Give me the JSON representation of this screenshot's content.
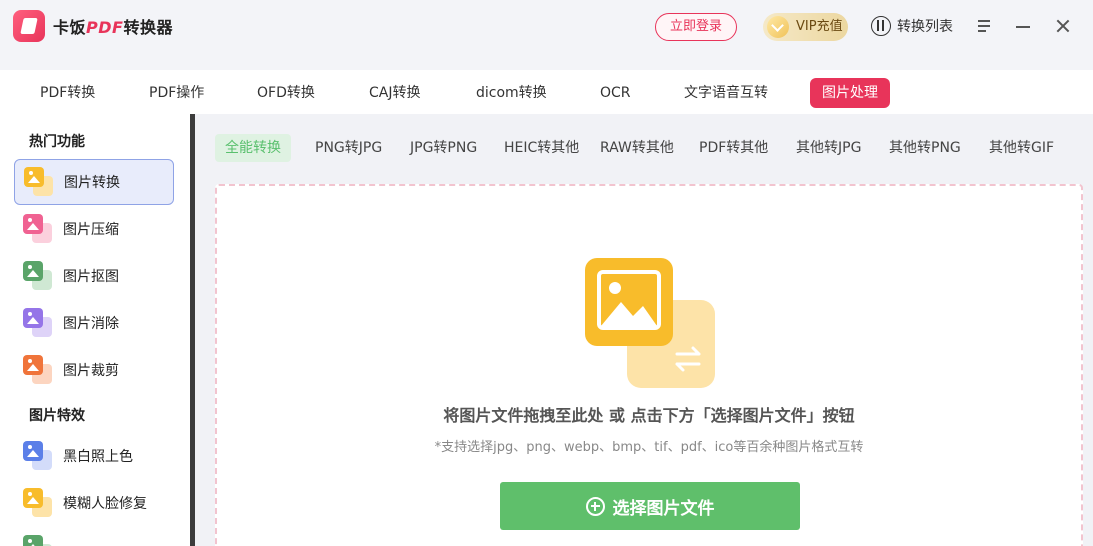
{
  "app": {
    "name_prefix": "卡饭",
    "name_pdf": "PDF",
    "name_suffix": "转换器"
  },
  "header": {
    "login": "立即登录",
    "vip": "VIP充值",
    "convert_list": "转换列表"
  },
  "tabs": [
    {
      "label": "PDF转换"
    },
    {
      "label": "PDF操作"
    },
    {
      "label": "OFD转换"
    },
    {
      "label": "CAJ转换"
    },
    {
      "label": "dicom转换"
    },
    {
      "label": "OCR"
    },
    {
      "label": "文字语音互转"
    },
    {
      "label": "图片处理"
    }
  ],
  "active_tab": "图片处理",
  "sidebar": {
    "group1": "热门功能",
    "items1": [
      {
        "label": "图片转换",
        "icon": "image-convert-icon",
        "color": "#f8bc2b"
      },
      {
        "label": "图片压缩",
        "icon": "image-compress-icon",
        "color": "#f06292"
      },
      {
        "label": "图片抠图",
        "icon": "image-cutout-icon",
        "color": "#5aa469"
      },
      {
        "label": "图片消除",
        "icon": "image-erase-icon",
        "color": "#9575e8"
      },
      {
        "label": "图片裁剪",
        "icon": "image-crop-icon",
        "color": "#f0743a"
      }
    ],
    "group2": "图片特效",
    "items2": [
      {
        "label": "黑白照上色",
        "icon": "colorize-icon",
        "color": "#5b7fe8"
      },
      {
        "label": "模糊人脸修复",
        "icon": "face-restore-icon",
        "color": "#f8bc2b"
      }
    ]
  },
  "subtabs": [
    {
      "label": "全能转换"
    },
    {
      "label": "PNG转JPG"
    },
    {
      "label": "JPG转PNG"
    },
    {
      "label": "HEIC转其他"
    },
    {
      "label": "RAW转其他"
    },
    {
      "label": "PDF转其他"
    },
    {
      "label": "其他转JPG"
    },
    {
      "label": "其他转PNG"
    },
    {
      "label": "其他转GIF"
    }
  ],
  "dropzone": {
    "hint": "将图片文件拖拽至此处 或 点击下方「选择图片文件」按钮",
    "sub": "*支持选择jpg、png、webp、bmp、tif、pdf、ico等百余种图片格式互转",
    "button": "选择图片文件"
  },
  "colors": {
    "brand": "#e8345a",
    "accent_green": "#5fbf6b",
    "active_blue": "#8fa3e6"
  }
}
